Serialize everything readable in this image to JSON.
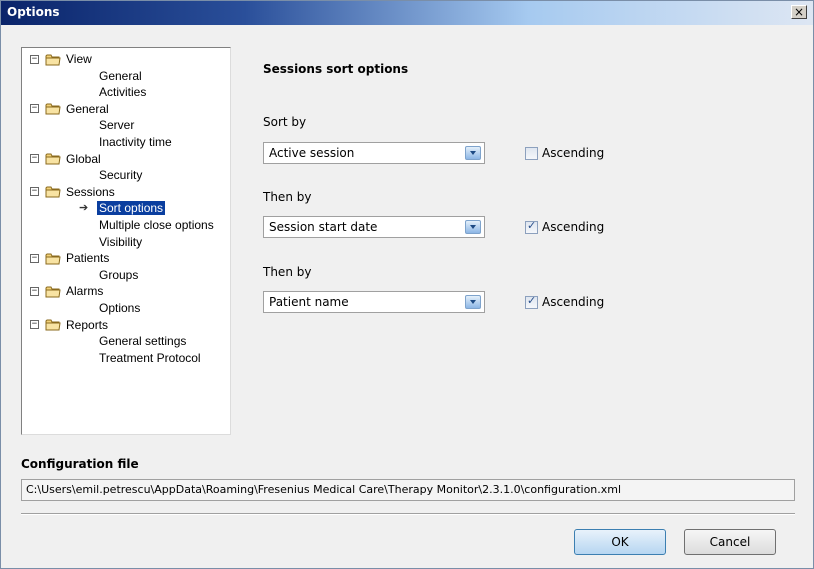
{
  "window": {
    "title": "Options",
    "close_glyph": "×"
  },
  "tree": {
    "groups": [
      {
        "label": "View",
        "expander": "−",
        "children": [
          "General",
          "Activities"
        ]
      },
      {
        "label": "General",
        "expander": "−",
        "children": [
          "Server",
          "Inactivity time"
        ]
      },
      {
        "label": "Global",
        "expander": "−",
        "children": [
          "Security"
        ]
      },
      {
        "label": "Sessions",
        "expander": "−",
        "children": [
          "Sort options",
          "Multiple close options",
          "Visibility"
        ]
      },
      {
        "label": "Patients",
        "expander": "−",
        "children": [
          "Groups"
        ]
      },
      {
        "label": "Alarms",
        "expander": "−",
        "children": [
          "Options"
        ]
      },
      {
        "label": "Reports",
        "expander": "−",
        "children": [
          "General settings",
          "Treatment Protocol"
        ]
      }
    ],
    "selected": "Sort options",
    "selected_marker": "➔"
  },
  "panel": {
    "title": "Sessions sort options",
    "sort_by_label": "Sort by",
    "then_by_label_1": "Then by",
    "then_by_label_2": "Then by",
    "combo1_value": "Active session",
    "combo2_value": "Session start date",
    "combo3_value": "Patient name",
    "ascending_label": "Ascending",
    "check1": false,
    "check2": true,
    "check3": true,
    "check_mark": "✓"
  },
  "config": {
    "label": "Configuration file",
    "path": "C:\\Users\\emil.petrescu\\AppData\\Roaming\\Fresenius Medical Care\\Therapy Monitor\\2.3.1.0\\configuration.xml"
  },
  "buttons": {
    "ok": "OK",
    "cancel": "Cancel"
  },
  "icons": {
    "folder": "folder-icon",
    "close": "close-icon",
    "dropdown": "chevron-down-icon"
  }
}
